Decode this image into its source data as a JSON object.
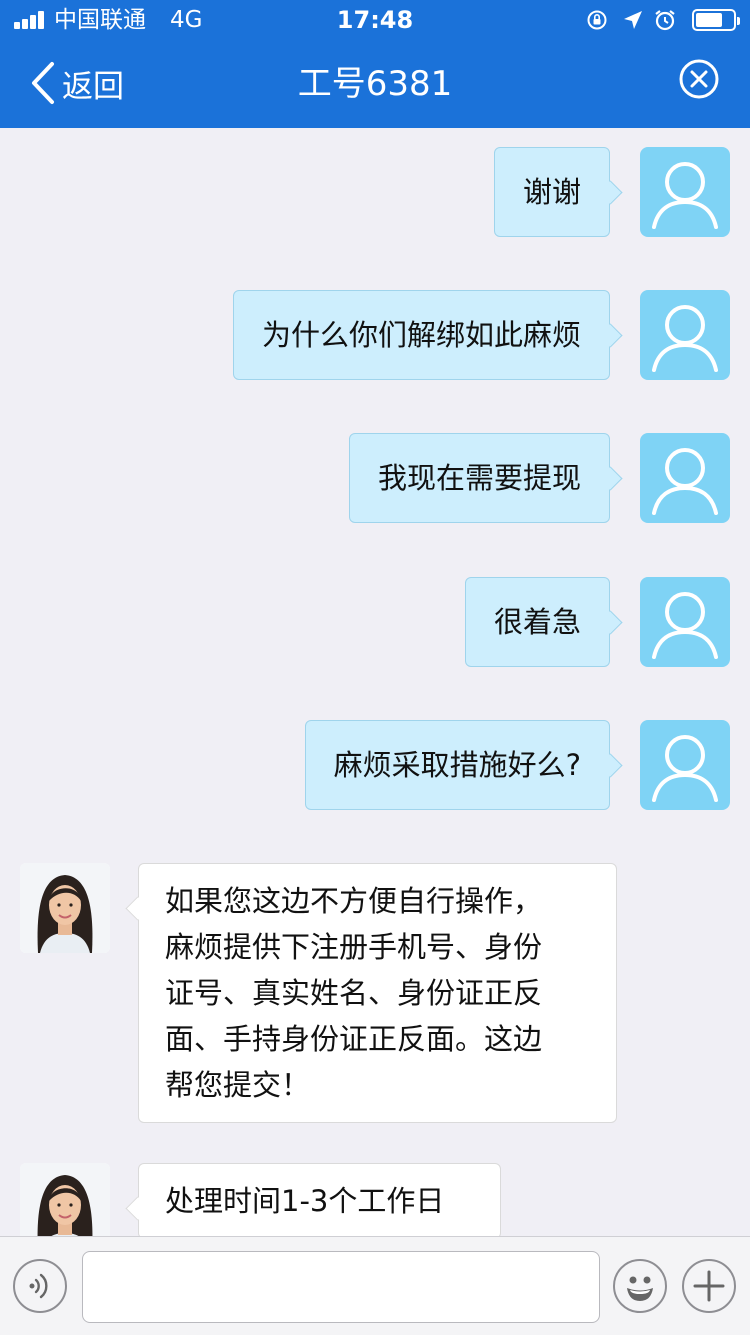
{
  "status_bar": {
    "carrier": "中国联通",
    "network": "4G",
    "time": "17:48",
    "icons": [
      "orientation-lock-icon",
      "location-arrow-icon",
      "alarm-icon",
      "battery-icon"
    ]
  },
  "nav": {
    "back_label": "返回",
    "title": "工号6381",
    "close_icon": "close-circle-icon"
  },
  "colors": {
    "header": "#1b72d9",
    "user_bubble": "#cdeefd",
    "user_avatar": "#7fd3f5",
    "agent_bubble": "#ffffff",
    "chat_background": "#f0eff5"
  },
  "messages": [
    {
      "from": "user",
      "text": "谢谢"
    },
    {
      "from": "user",
      "text": "为什么你们解绑如此麻烦"
    },
    {
      "from": "user",
      "text": "我现在需要提现"
    },
    {
      "from": "user",
      "text": "很着急"
    },
    {
      "from": "user",
      "text": "麻烦采取措施好么?"
    },
    {
      "from": "agent",
      "lines": [
        "如果您这边不方便自行操作，",
        "麻烦提供下注册手机号、身份",
        "证号、真实姓名、身份证正反",
        "面、手持身份证正反面。这边",
        "帮您提交！"
      ]
    },
    {
      "from": "agent",
      "lines": [
        "处理时间1-3个工作日"
      ]
    }
  ],
  "input_bar": {
    "value": "",
    "left_icon": "voice-icon",
    "emoji_icon": "emoji-icon",
    "plus_icon": "plus-icon"
  }
}
